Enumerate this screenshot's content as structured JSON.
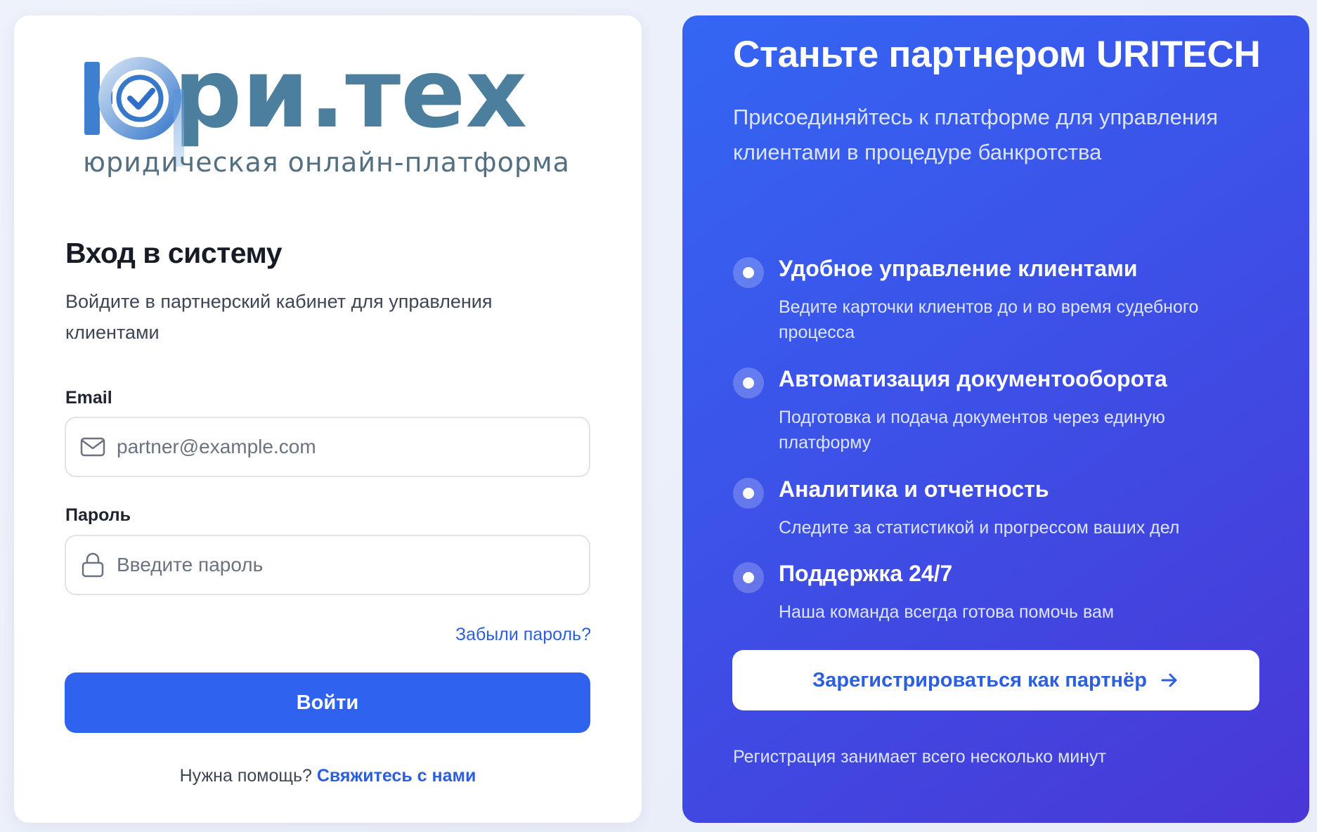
{
  "logo": {
    "brand": "юри.тех",
    "wordmark": "ри.тех",
    "tagline": "юридическая онлайн-платформа",
    "colors": {
      "text": "#4a7a99",
      "gradient_start": "#3f7fcf",
      "gradient_end": "#c8dcf0",
      "check": "#2f6ec8"
    }
  },
  "login": {
    "title": "Вход в систему",
    "subtitle": "Войдите в партнерский кабинет для управления клиентами",
    "email": {
      "label": "Email",
      "placeholder": "partner@example.com",
      "value": "",
      "icon": "mail-icon"
    },
    "password": {
      "label": "Пароль",
      "placeholder": "Введите пароль",
      "value": "",
      "icon": "lock-icon"
    },
    "forgot_link": "Забыли пароль?",
    "submit_label": "Войти",
    "help_text": "Нужна помощь?",
    "help_link": "Свяжитесь с нами"
  },
  "partner": {
    "title": "Станьте партнером URITECH",
    "subtitle": "Присоединяйтесь к платформе для управления клиентами в процедуре банкротства",
    "features": [
      {
        "title": "Удобное управление клиентами",
        "description": "Ведите карточки клиентов до и во время судебного процесса"
      },
      {
        "title": "Автоматизация документооборота",
        "description": "Подготовка и подача документов через единую платформу"
      },
      {
        "title": "Аналитика и отчетность",
        "description": "Следите за статистикой и прогрессом ваших дел"
      },
      {
        "title": "Поддержка 24/7",
        "description": "Наша команда всегда готова помочь вам"
      }
    ],
    "register_label": "Зарегистрироваться как партнёр",
    "register_icon": "arrow-right-icon",
    "register_note": "Регистрация занимает всего несколько минут"
  },
  "colors": {
    "primary": "#2f62ee",
    "link": "#2b5fdb",
    "panel_gradient_start": "#3466f3",
    "panel_gradient_end": "#4a37d6"
  }
}
